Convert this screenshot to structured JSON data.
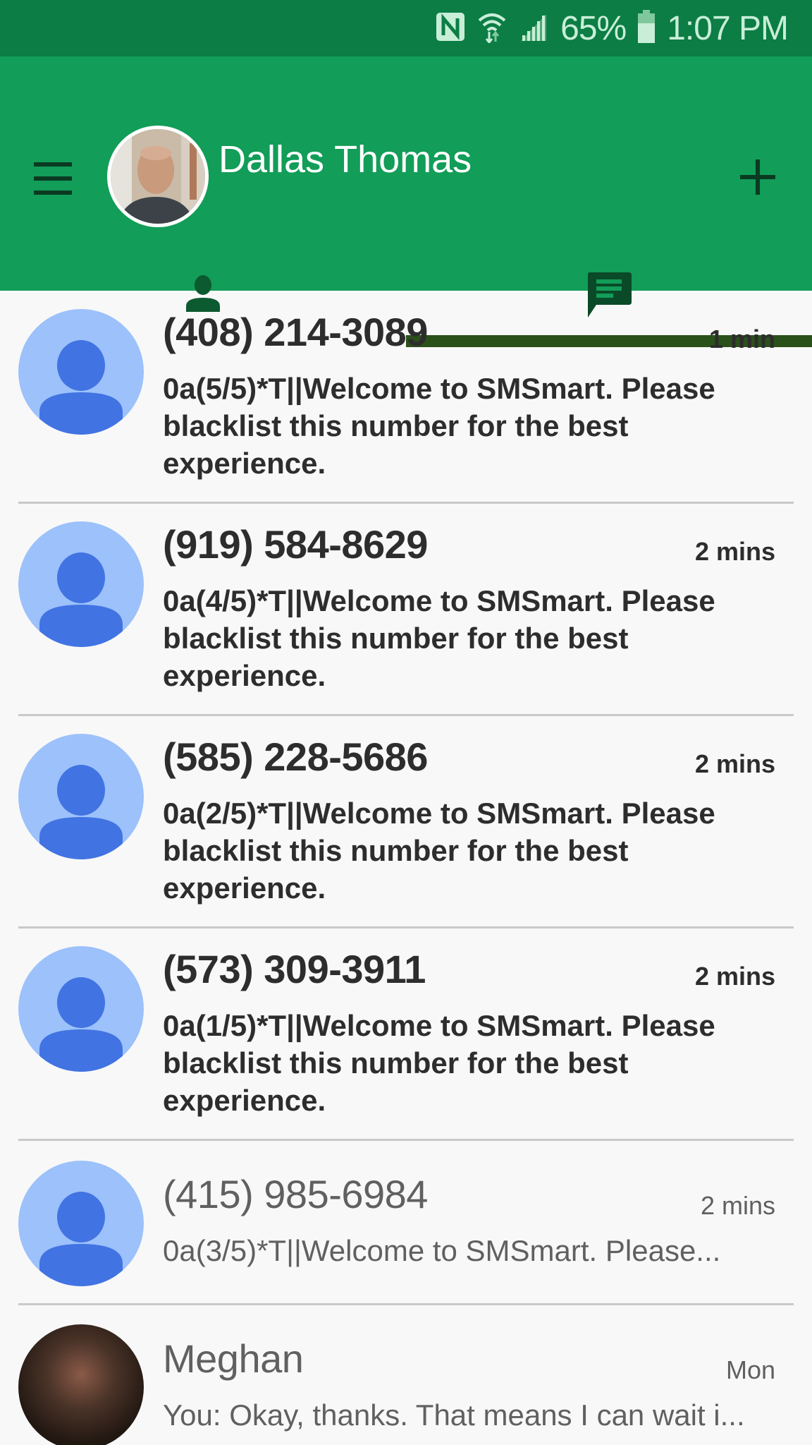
{
  "status_bar": {
    "icons": [
      "nfc-icon",
      "wifi-icon",
      "cell-signal-icon",
      "battery-icon"
    ],
    "battery": "65%",
    "time": "1:07 PM"
  },
  "header": {
    "menu_icon": "hamburger-menu-icon",
    "profile_name": "Dallas Thomas",
    "add_icon": "plus-icon",
    "tabs": [
      {
        "name": "contacts",
        "icon": "person-icon",
        "selected": false
      },
      {
        "name": "messages",
        "icon": "message-icon",
        "selected": true
      }
    ]
  },
  "colors": {
    "status_bar": "#0c7d44",
    "header": "#129d58",
    "tab_indicator": "#2b511b",
    "avatar_bg": "#9cc1fb",
    "avatar_fg": "#4173e2"
  },
  "conversations": [
    {
      "name": "(408) 214-3089",
      "time": "1 min",
      "preview": "0a(5/5)*T||Welcome to SMSmart. Please blacklist this number for the best experience.",
      "unread": true
    },
    {
      "name": "(919) 584-8629",
      "time": "2 mins",
      "preview": "0a(4/5)*T||Welcome to SMSmart. Please blacklist this number for the best experience.",
      "unread": true
    },
    {
      "name": "(585) 228-5686",
      "time": "2 mins",
      "preview": "0a(2/5)*T||Welcome to SMSmart. Please blacklist this number for the best experience.",
      "unread": true
    },
    {
      "name": "(573) 309-3911",
      "time": "2 mins",
      "preview": "0a(1/5)*T||Welcome to SMSmart. Please blacklist this number for the best experience.",
      "unread": true
    },
    {
      "name": "(415) 985-6984",
      "time": "2 mins",
      "preview": "0a(3/5)*T||Welcome to SMSmart. Please...",
      "unread": false
    },
    {
      "name": "Meghan",
      "time": "Mon",
      "preview": "You: Okay, thanks. That means I can wait i...",
      "unread": false
    }
  ]
}
